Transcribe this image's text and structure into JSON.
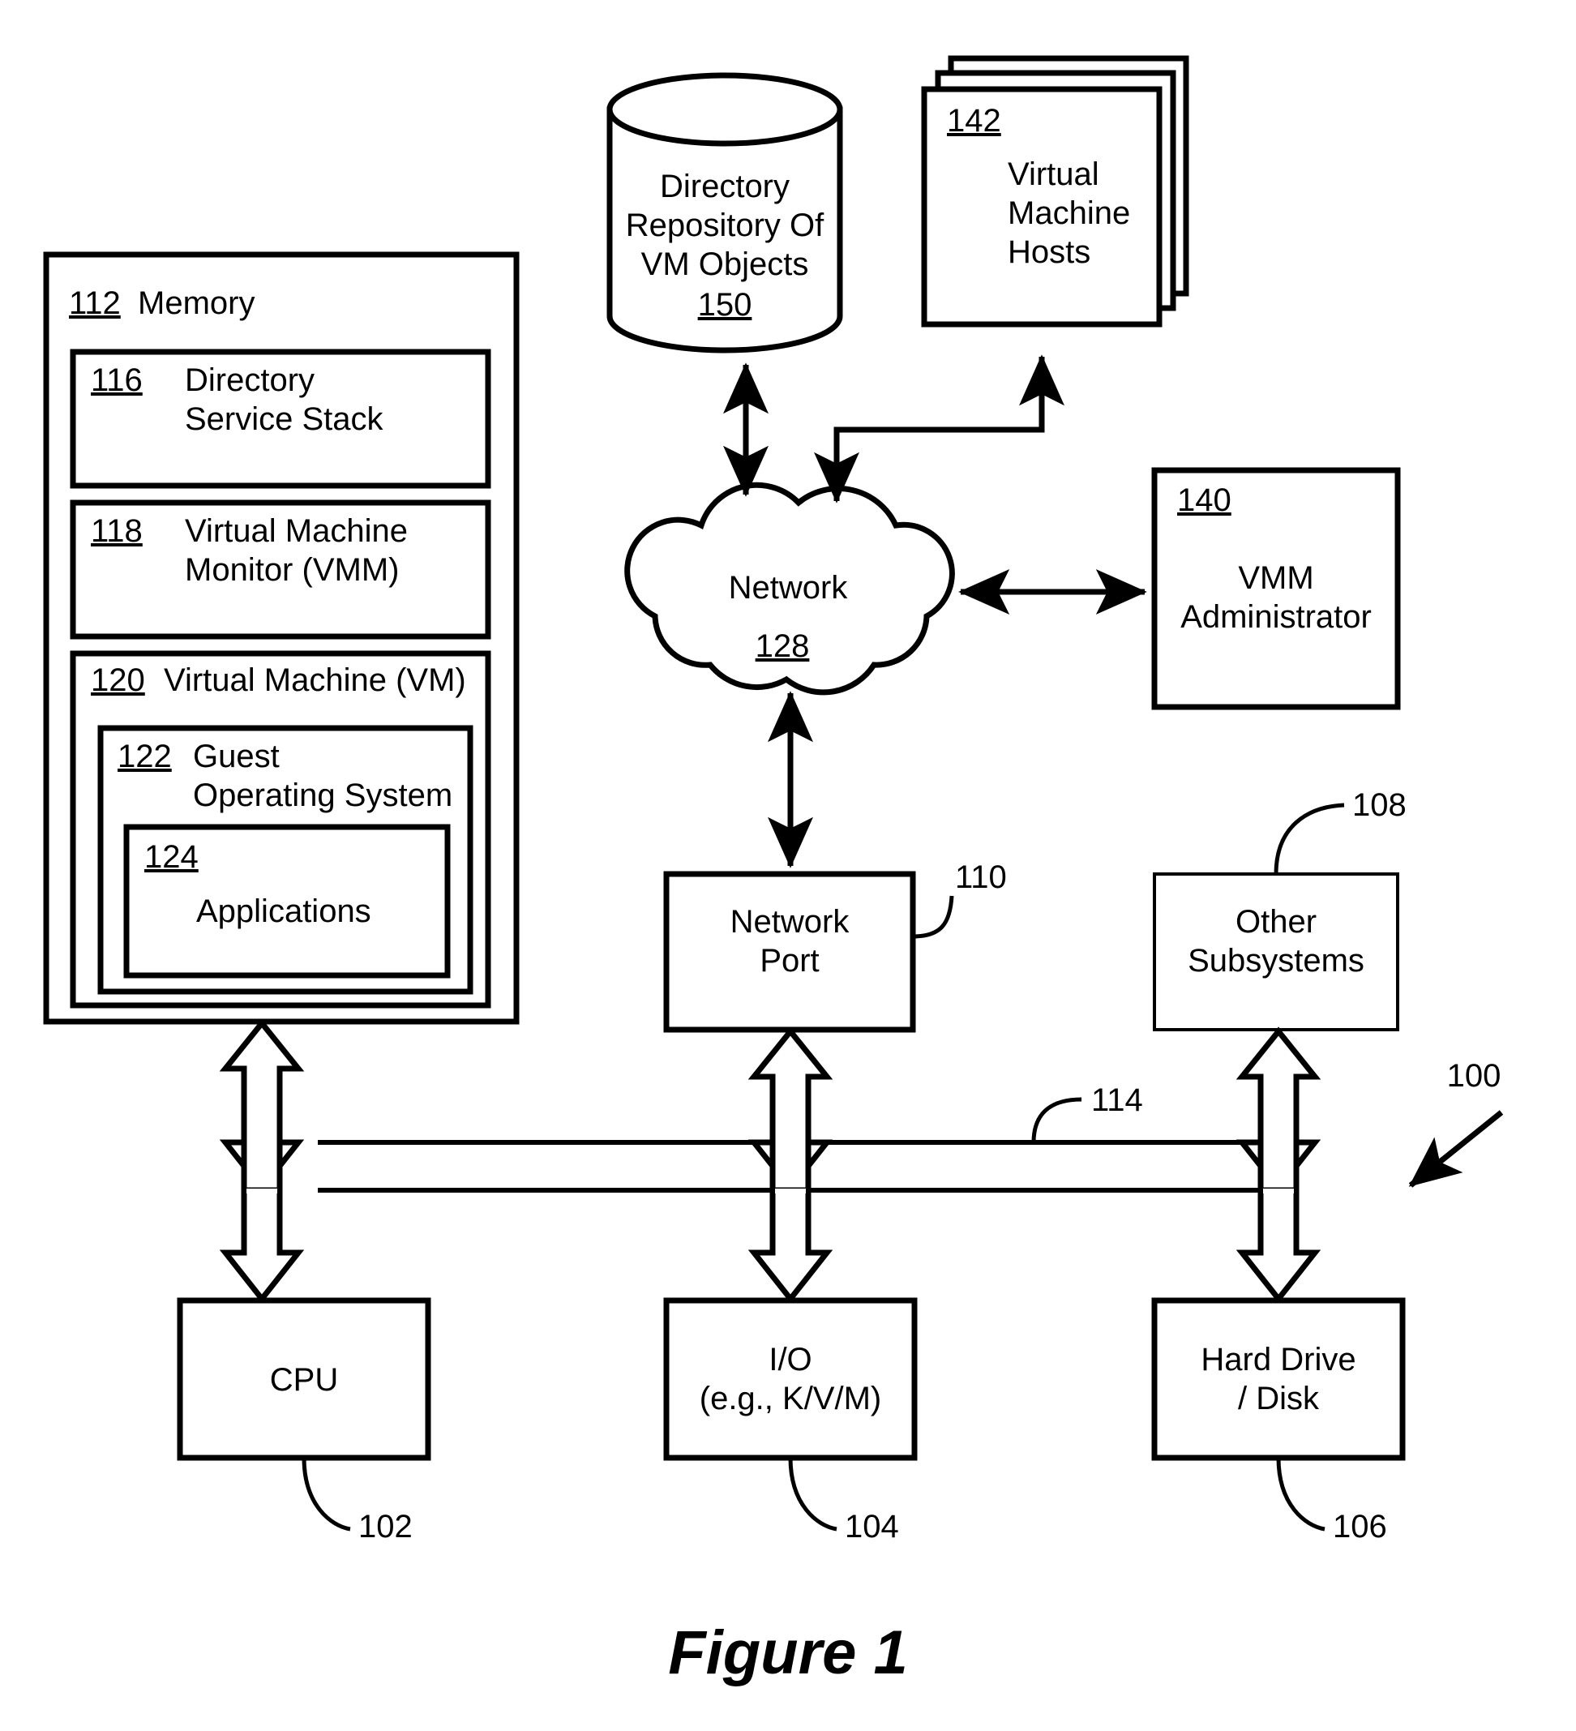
{
  "figure": {
    "caption": "Figure 1",
    "system_ref": "100"
  },
  "memory": {
    "ref": "112",
    "label": "Memory",
    "blocks": [
      {
        "ref": "116",
        "lines": [
          "Directory",
          "Service Stack"
        ]
      },
      {
        "ref": "118",
        "lines": [
          "Virtual Machine",
          "Monitor (VMM)"
        ]
      }
    ],
    "vm": {
      "ref": "120",
      "label": "Virtual Machine (VM)",
      "guest_os": {
        "ref": "122",
        "lines": [
          "Guest",
          "Operating System"
        ],
        "applications": {
          "ref": "124",
          "label": "Applications"
        }
      }
    }
  },
  "repository": {
    "ref": "150",
    "lines": [
      "Directory",
      "Repository Of",
      "VM Objects"
    ]
  },
  "vm_hosts": {
    "ref": "142",
    "lines": [
      "Virtual",
      "Machine",
      "Hosts"
    ]
  },
  "network": {
    "ref": "128",
    "label": "Network"
  },
  "vmm_admin": {
    "ref": "140",
    "lines": [
      "VMM",
      "Administrator"
    ]
  },
  "network_port": {
    "ref": "110",
    "lines": [
      "Network",
      "Port"
    ]
  },
  "other_subsystems": {
    "ref": "108",
    "lines": [
      "Other",
      "Subsystems"
    ]
  },
  "bus": {
    "ref": "114"
  },
  "cpu": {
    "ref": "102",
    "lines": [
      "CPU"
    ]
  },
  "io": {
    "ref": "104",
    "lines": [
      "I/O",
      "(e.g., K/V/M)"
    ]
  },
  "hard_drive": {
    "ref": "106",
    "lines": [
      "Hard Drive",
      "/ Disk"
    ]
  },
  "colors": {
    "stroke": "#000000",
    "fill": "#ffffff"
  }
}
